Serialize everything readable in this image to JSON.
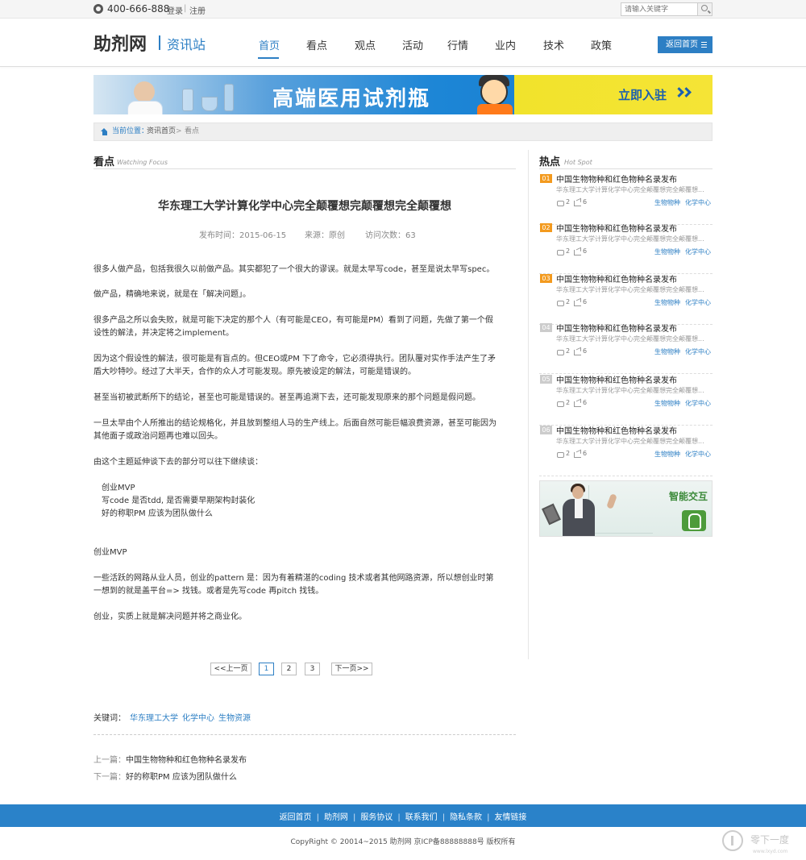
{
  "topbar": {
    "phone": "400-666-888",
    "login": "登录",
    "separator": "|",
    "register": "注册",
    "search_placeholder": "请输入关键字"
  },
  "header": {
    "logo": "助剂网",
    "logo_sub": "资讯站",
    "nav": [
      {
        "label": "首页",
        "active": true
      },
      {
        "label": "看点",
        "active": false
      },
      {
        "label": "观点",
        "active": false
      },
      {
        "label": "活动",
        "active": false
      },
      {
        "label": "行情",
        "active": false
      },
      {
        "label": "业内",
        "active": false
      },
      {
        "label": "技术",
        "active": false
      },
      {
        "label": "政策",
        "active": false
      }
    ],
    "back_home": "返回首页"
  },
  "banner": {
    "title": "高端医用试剂瓶",
    "cta": "立即入驻"
  },
  "breadcrumb": {
    "lead": "当前位置：",
    "items": [
      "资讯首页",
      "看点"
    ],
    "sep": ">"
  },
  "main": {
    "section_title": "看点",
    "section_en": "Watching Focus",
    "article": {
      "title": "华东理工大学计算化学中心完全颠覆想完颠覆想完全颠覆想",
      "publish_time": "发布时间：2015-06-15",
      "source": "来源：原创",
      "visits": "访问次数：63",
      "paragraphs": [
        "很多人做产品，包括我很久以前做产品。其实都犯了一个很大的谬误。就是太早写code，甚至是说太早写spec。",
        "做产品，精确地来说，就是在「解决问题」。",
        "很多产品之所以会失败，就是可能下决定的那个人（有可能是CEO，有可能是PM）看到了问题，先做了第一个假设性的解法，并决定将之implement。",
        "因为这个假设性的解法，很可能是有盲点的。但CEO或PM 下了命令，它必须得执行。团队覆对实作手法产生了矛盾大吵特吵。经过了大半天，合作的众人才可能发现。原先被设定的解法，可能是错误的。",
        "甚至当初被武断所下的结论，甚至也可能是错误的。甚至再追溯下去，还可能发现原来的那个问题是假问题。",
        "一旦太早由个人所推出的结论规格化，并且放到整组人马的生产线上。后面自然可能巨幅浪费资源，甚至可能因为其他面子或政治问题再也难以回头。",
        "由这个主题延伸谈下去的部分可以往下继续谈：",
        "创业MVP",
        "写code 是否tdd, 是否需要早期架构封装化",
        "好的称职PM 应该为团队做什么",
        "创业MVP",
        "一些活跃的网路从业人员，创业的pattern 是：因为有着精湛的coding 技术或者其他网路资源，所以想创业时第一想到的就是盖平台=> 找钱。或者是先写code 再pitch 找钱。",
        "创业，实质上就是解决问题并将之商业化。"
      ]
    },
    "pager": {
      "prev": "<<上一页",
      "pages": [
        "1",
        "2",
        "3"
      ],
      "active_page": "1",
      "next": "下一页>>"
    },
    "keywords_label": "关键词：",
    "keywords": [
      "华东理工大学",
      "化学中心",
      "生物资源"
    ],
    "prev_label": "上一篇：",
    "prev_title": "中国生物物种和红色物种名录发布",
    "next_label": "下一篇：",
    "next_title": "好的称职PM 应该为团队做什么"
  },
  "sidebar": {
    "section_title": "热点",
    "section_en": "Hot Spot",
    "items": [
      {
        "num": "01",
        "title": "中国生物物种和红色物种名录发布",
        "desc": "华东理工大学计算化学中心完全颠覆想完全颠覆想...",
        "comments": "2",
        "shares": "6",
        "tags": [
          "生物物种",
          "化学中心"
        ],
        "highlight": true
      },
      {
        "num": "02",
        "title": "中国生物物种和红色物种名录发布",
        "desc": "华东理工大学计算化学中心完全颠覆想完全颠覆想...",
        "comments": "2",
        "shares": "6",
        "tags": [
          "生物物种",
          "化学中心"
        ],
        "highlight": true
      },
      {
        "num": "03",
        "title": "中国生物物种和红色物种名录发布",
        "desc": "华东理工大学计算化学中心完全颠覆想完全颠覆想...",
        "comments": "2",
        "shares": "6",
        "tags": [
          "生物物种",
          "化学中心"
        ],
        "highlight": true
      },
      {
        "num": "04",
        "title": "中国生物物种和红色物种名录发布",
        "desc": "华东理工大学计算化学中心完全颠覆想完全颠覆想...",
        "comments": "2",
        "shares": "6",
        "tags": [
          "生物物种",
          "化学中心"
        ],
        "highlight": false
      },
      {
        "num": "05",
        "title": "中国生物物种和红色物种名录发布",
        "desc": "华东理工大学计算化学中心完全颠覆想完全颠覆想...",
        "comments": "2",
        "shares": "6",
        "tags": [
          "生物物种",
          "化学中心"
        ],
        "highlight": false
      },
      {
        "num": "06",
        "title": "中国生物物种和红色物种名录发布",
        "desc": "华东理工大学计算化学中心完全颠覆想完全颠覆想...",
        "comments": "2",
        "shares": "6",
        "tags": [
          "生物物种",
          "化学中心"
        ],
        "highlight": false
      }
    ],
    "ad_label": "智能交互"
  },
  "footer": {
    "links": [
      "返回首页",
      "助剂网",
      "服务协议",
      "联系我们",
      "隐私条款",
      "友情链接"
    ],
    "separator": "|",
    "copyright": "CopyRight © 20014~2015 助剂网 京ICP备88888888号 版权所有"
  },
  "watermark": {
    "text": "零下一度",
    "url": "www.lxyd.com"
  },
  "colors": {
    "accent": "#2d7fc4",
    "hot_highlight": "#f39a1e",
    "hot_normal": "#cccccc",
    "footer": "#2a82c9"
  }
}
